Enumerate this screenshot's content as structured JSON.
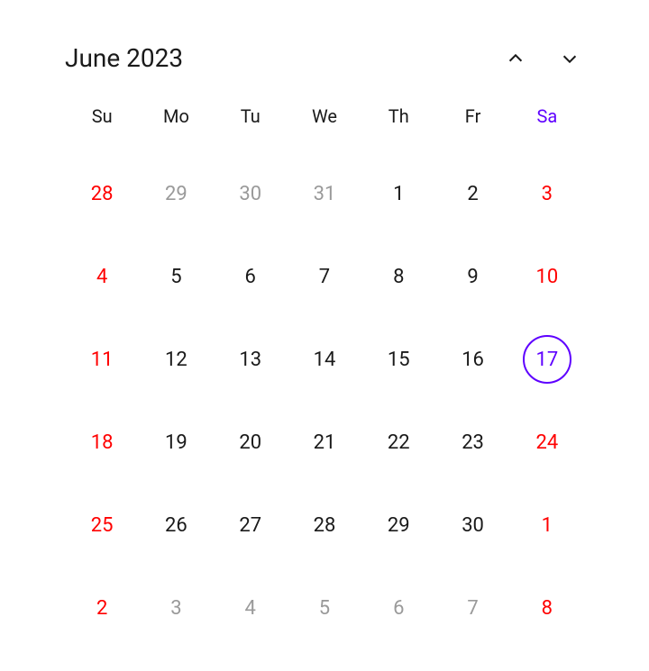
{
  "title": "June 2023",
  "accent_color": "#5e00ff",
  "weekend_color": "#ff0000",
  "outside_color": "#9a9a9a",
  "day_headers": [
    {
      "label": "Su",
      "accent": false
    },
    {
      "label": "Mo",
      "accent": false
    },
    {
      "label": "Tu",
      "accent": false
    },
    {
      "label": "We",
      "accent": false
    },
    {
      "label": "Th",
      "accent": false
    },
    {
      "label": "Fr",
      "accent": false
    },
    {
      "label": "Sa",
      "accent": true
    }
  ],
  "weeks": [
    [
      {
        "day": "28",
        "outside": true,
        "weekend": true,
        "today": false
      },
      {
        "day": "29",
        "outside": true,
        "weekend": false,
        "today": false
      },
      {
        "day": "30",
        "outside": true,
        "weekend": false,
        "today": false
      },
      {
        "day": "31",
        "outside": true,
        "weekend": false,
        "today": false
      },
      {
        "day": "1",
        "outside": false,
        "weekend": false,
        "today": false
      },
      {
        "day": "2",
        "outside": false,
        "weekend": false,
        "today": false
      },
      {
        "day": "3",
        "outside": false,
        "weekend": true,
        "today": false
      }
    ],
    [
      {
        "day": "4",
        "outside": false,
        "weekend": true,
        "today": false
      },
      {
        "day": "5",
        "outside": false,
        "weekend": false,
        "today": false
      },
      {
        "day": "6",
        "outside": false,
        "weekend": false,
        "today": false
      },
      {
        "day": "7",
        "outside": false,
        "weekend": false,
        "today": false
      },
      {
        "day": "8",
        "outside": false,
        "weekend": false,
        "today": false
      },
      {
        "day": "9",
        "outside": false,
        "weekend": false,
        "today": false
      },
      {
        "day": "10",
        "outside": false,
        "weekend": true,
        "today": false
      }
    ],
    [
      {
        "day": "11",
        "outside": false,
        "weekend": true,
        "today": false
      },
      {
        "day": "12",
        "outside": false,
        "weekend": false,
        "today": false
      },
      {
        "day": "13",
        "outside": false,
        "weekend": false,
        "today": false
      },
      {
        "day": "14",
        "outside": false,
        "weekend": false,
        "today": false
      },
      {
        "day": "15",
        "outside": false,
        "weekend": false,
        "today": false
      },
      {
        "day": "16",
        "outside": false,
        "weekend": false,
        "today": false
      },
      {
        "day": "17",
        "outside": false,
        "weekend": true,
        "today": true
      }
    ],
    [
      {
        "day": "18",
        "outside": false,
        "weekend": true,
        "today": false
      },
      {
        "day": "19",
        "outside": false,
        "weekend": false,
        "today": false
      },
      {
        "day": "20",
        "outside": false,
        "weekend": false,
        "today": false
      },
      {
        "day": "21",
        "outside": false,
        "weekend": false,
        "today": false
      },
      {
        "day": "22",
        "outside": false,
        "weekend": false,
        "today": false
      },
      {
        "day": "23",
        "outside": false,
        "weekend": false,
        "today": false
      },
      {
        "day": "24",
        "outside": false,
        "weekend": true,
        "today": false
      }
    ],
    [
      {
        "day": "25",
        "outside": false,
        "weekend": true,
        "today": false
      },
      {
        "day": "26",
        "outside": false,
        "weekend": false,
        "today": false
      },
      {
        "day": "27",
        "outside": false,
        "weekend": false,
        "today": false
      },
      {
        "day": "28",
        "outside": false,
        "weekend": false,
        "today": false
      },
      {
        "day": "29",
        "outside": false,
        "weekend": false,
        "today": false
      },
      {
        "day": "30",
        "outside": false,
        "weekend": false,
        "today": false
      },
      {
        "day": "1",
        "outside": true,
        "weekend": true,
        "today": false
      }
    ],
    [
      {
        "day": "2",
        "outside": true,
        "weekend": true,
        "today": false
      },
      {
        "day": "3",
        "outside": true,
        "weekend": false,
        "today": false
      },
      {
        "day": "4",
        "outside": true,
        "weekend": false,
        "today": false
      },
      {
        "day": "5",
        "outside": true,
        "weekend": false,
        "today": false
      },
      {
        "day": "6",
        "outside": true,
        "weekend": false,
        "today": false
      },
      {
        "day": "7",
        "outside": true,
        "weekend": false,
        "today": false
      },
      {
        "day": "8",
        "outside": true,
        "weekend": true,
        "today": false
      }
    ]
  ]
}
